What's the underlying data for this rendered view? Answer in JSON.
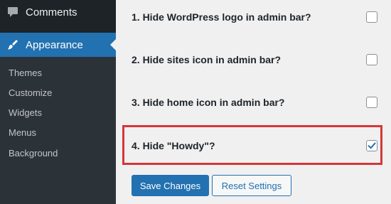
{
  "sidebar": {
    "comments_label": "Comments",
    "appearance_label": "Appearance",
    "submenu": [
      {
        "label": "Themes"
      },
      {
        "label": "Customize"
      },
      {
        "label": "Widgets"
      },
      {
        "label": "Menus"
      },
      {
        "label": "Background"
      }
    ],
    "icons": {
      "comments": "comment-bubble-icon",
      "appearance": "paintbrush-icon"
    }
  },
  "settings": {
    "options": [
      {
        "label": "1. Hide WordPress logo in admin bar?",
        "checked": false
      },
      {
        "label": "2. Hide sites icon in admin bar?",
        "checked": false
      },
      {
        "label": "3. Hide home icon in admin bar?",
        "checked": false
      },
      {
        "label": "4. Hide \"Howdy\"?",
        "checked": true
      }
    ],
    "save_label": "Save Changes",
    "reset_label": "Reset Settings"
  },
  "colors": {
    "sidebar_bg": "#1d2327",
    "submenu_bg": "#2c3338",
    "accent": "#2271b1",
    "highlight": "#d63638",
    "content_bg": "#f0f0f1"
  }
}
